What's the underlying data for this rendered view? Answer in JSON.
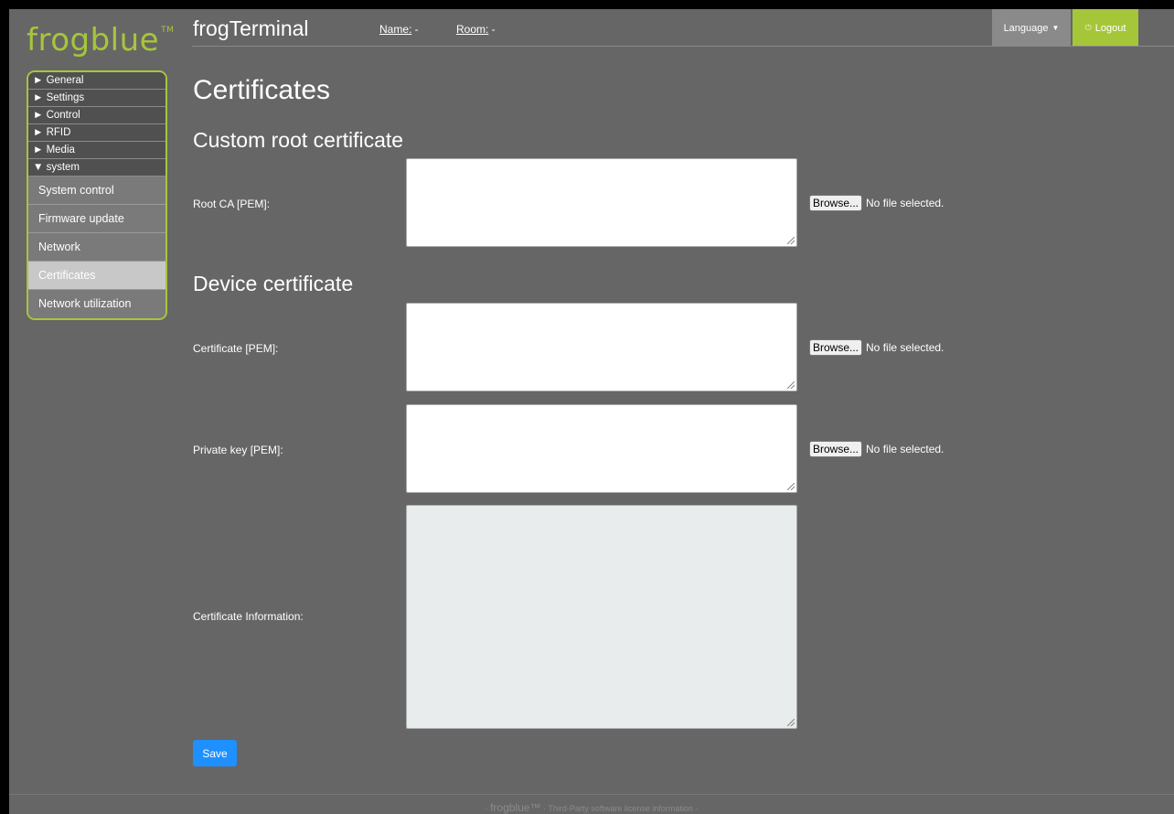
{
  "brand": {
    "logo_text": "frogblue",
    "trademark": "TM"
  },
  "header": {
    "title": "frogTerminal",
    "name_label": "Name:",
    "name_value": " -",
    "room_label": "Room:",
    "room_value": " -",
    "language_label": "Language",
    "logout_label": "Logout"
  },
  "sidebar": {
    "menus": [
      {
        "label": "► General"
      },
      {
        "label": "► Settings"
      },
      {
        "label": "► Control"
      },
      {
        "label": "► RFID"
      },
      {
        "label": "► Media"
      },
      {
        "label": "▼ system"
      }
    ],
    "submenu": [
      {
        "label": "System control"
      },
      {
        "label": "Firmware update"
      },
      {
        "label": "Network"
      },
      {
        "label": "Certificates",
        "active": true
      },
      {
        "label": "Network utilization"
      }
    ]
  },
  "main": {
    "page_title": "Certificates",
    "custom_root": {
      "title": "Custom root certificate",
      "root_ca_label": "Root CA [PEM]:"
    },
    "device": {
      "title": "Device certificate",
      "certificate_label": "Certificate [PEM]:",
      "private_key_label": "Private key [PEM]:",
      "info_label": "Certificate Information:"
    },
    "browse_label": "Browse...",
    "no_file_text": "No file selected.",
    "save_label": "Save"
  },
  "footer": {
    "brand": "frogblue™",
    "license_link": "Third-Party software license information",
    "separator": "·"
  },
  "colors": {
    "accent_green": "#a6c63a",
    "background": "#666666",
    "save_blue": "#1e90ff"
  }
}
